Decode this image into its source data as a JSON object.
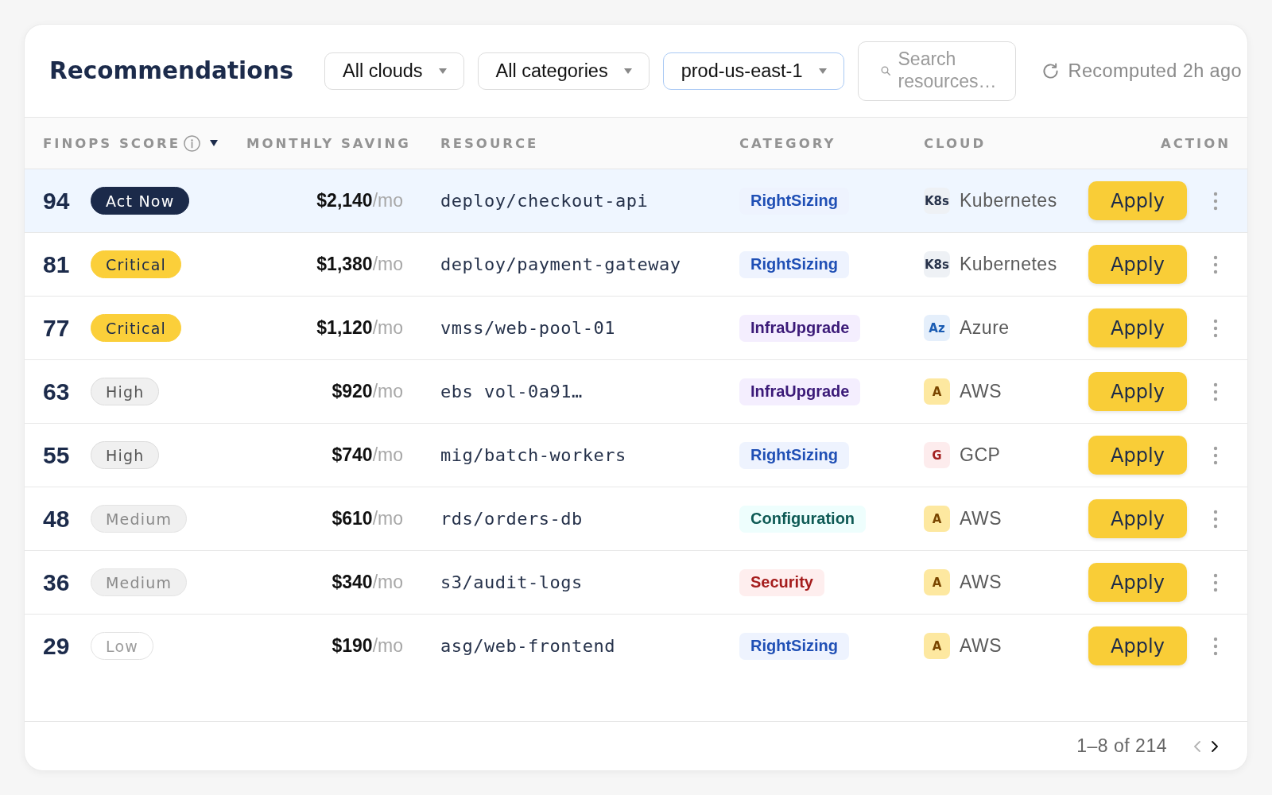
{
  "header": {
    "title": "Recommendations",
    "filters": [
      {
        "value": "All clouds",
        "active": false
      },
      {
        "value": "All categories",
        "active": false
      },
      {
        "value": "prod-us-east-1",
        "active": true
      }
    ],
    "search": {
      "placeholder": "Search resources…"
    },
    "status": "Recomputed 2h ago"
  },
  "table": {
    "columns": [
      {
        "label": "FINOPS SCORE",
        "info": true,
        "sorted": true
      },
      {
        "label": "MONTHLY SAVING"
      },
      {
        "label": "RESOURCE"
      },
      {
        "label": "CATEGORY"
      },
      {
        "label": "CLOUD"
      },
      {
        "label": "ACTION"
      }
    ],
    "rows": [
      {
        "selected": true,
        "score": "94",
        "priority": {
          "label": "Act Now",
          "kind": "urgent"
        },
        "saving": {
          "amount": "$2,140",
          "unit": "/mo"
        },
        "resource": "deploy/checkout-api",
        "category": {
          "label": "RightSizing",
          "color": "#1f4fb5"
        },
        "cloud": {
          "logo": "K8s",
          "name": "Kubernetes",
          "kind": "k8s"
        },
        "action": "Apply"
      },
      {
        "selected": false,
        "score": "81",
        "priority": {
          "label": "Critical",
          "kind": "critical"
        },
        "saving": {
          "amount": "$1,380",
          "unit": "/mo"
        },
        "resource": "deploy/payment-gateway",
        "category": {
          "label": "RightSizing",
          "color": "#1f4fb5"
        },
        "cloud": {
          "logo": "K8s",
          "name": "Kubernetes",
          "kind": "k8s"
        },
        "action": "Apply"
      },
      {
        "selected": false,
        "score": "77",
        "priority": {
          "label": "Critical",
          "kind": "critical"
        },
        "saving": {
          "amount": "$1,120",
          "unit": "/mo"
        },
        "resource": "vmss/web-pool-01",
        "category": {
          "label": "InfraUpgrade",
          "color": "#3b1a78"
        },
        "cloud": {
          "logo": "Az",
          "name": "Azure",
          "kind": "azure"
        },
        "action": "Apply"
      },
      {
        "selected": false,
        "score": "63",
        "priority": {
          "label": "High",
          "kind": "high"
        },
        "saving": {
          "amount": "$920",
          "unit": "/mo"
        },
        "resource": "ebs vol-0a91…",
        "category": {
          "label": "InfraUpgrade",
          "color": "#3b1a78"
        },
        "cloud": {
          "logo": "A",
          "name": "AWS",
          "kind": "aws"
        },
        "action": "Apply"
      },
      {
        "selected": false,
        "score": "55",
        "priority": {
          "label": "High",
          "kind": "high"
        },
        "saving": {
          "amount": "$740",
          "unit": "/mo"
        },
        "resource": "mig/batch-workers",
        "category": {
          "label": "RightSizing",
          "color": "#1f4fb5"
        },
        "cloud": {
          "logo": "G",
          "name": "GCP",
          "kind": "gcp"
        },
        "action": "Apply"
      },
      {
        "selected": false,
        "score": "48",
        "priority": {
          "label": "Medium",
          "kind": "medium"
        },
        "saving": {
          "amount": "$610",
          "unit": "/mo"
        },
        "resource": "rds/orders-db",
        "category": {
          "label": "Configuration",
          "color": "#0e5a55"
        },
        "cloud": {
          "logo": "A",
          "name": "AWS",
          "kind": "aws"
        },
        "action": "Apply"
      },
      {
        "selected": false,
        "score": "36",
        "priority": {
          "label": "Medium",
          "kind": "medium"
        },
        "saving": {
          "amount": "$340",
          "unit": "/mo"
        },
        "resource": "s3/audit-logs",
        "category": {
          "label": "Security",
          "color": "#a51d1d"
        },
        "cloud": {
          "logo": "A",
          "name": "AWS",
          "kind": "aws"
        },
        "action": "Apply"
      },
      {
        "selected": false,
        "score": "29",
        "priority": {
          "label": "Low",
          "kind": "low"
        },
        "saving": {
          "amount": "$190",
          "unit": "/mo"
        },
        "resource": "asg/web-frontend",
        "category": {
          "label": "RightSizing",
          "color": "#1f4fb5"
        },
        "cloud": {
          "logo": "A",
          "name": "AWS",
          "kind": "aws"
        },
        "action": "Apply"
      }
    ]
  },
  "pagination": {
    "range": "1–8 of 214",
    "previous": {
      "disabled": true
    },
    "next": {
      "disabled": false
    }
  }
}
